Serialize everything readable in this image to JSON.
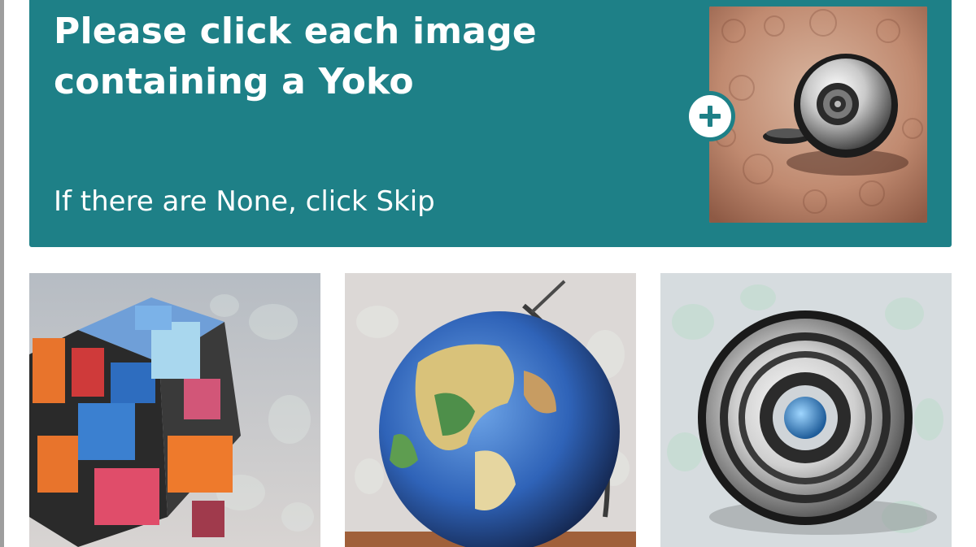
{
  "task": {
    "title": "Please click each image containing a Yoko",
    "subtitle": "If there are None, click Skip"
  },
  "colors": {
    "header_bg": "#1e8087",
    "text": "#ffffff"
  },
  "example_image": {
    "subject": "yo-yo on a textured surface",
    "expand_icon": "plus-icon"
  },
  "tiles": [
    {
      "subject": "rubik's cube"
    },
    {
      "subject": "globe"
    },
    {
      "subject": "yo-yo"
    }
  ]
}
